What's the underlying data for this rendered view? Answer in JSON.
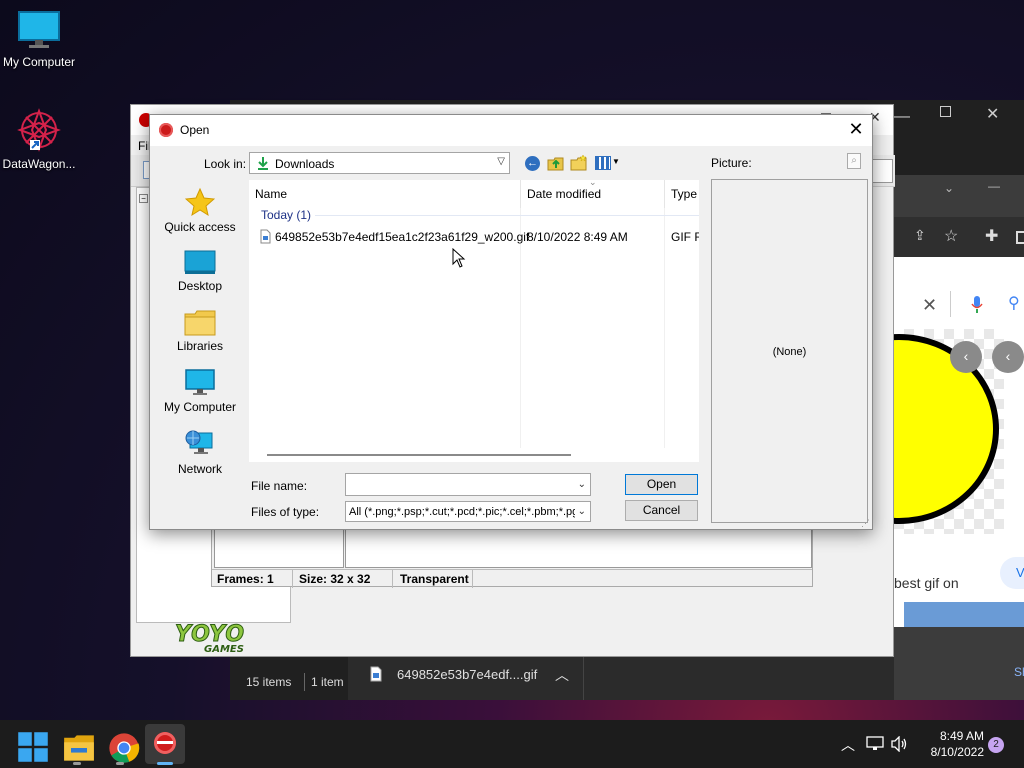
{
  "desktop": {
    "icons": [
      {
        "label": "My Computer"
      },
      {
        "label": "DataWagon..."
      }
    ]
  },
  "background": {
    "gm_menu_partial": "Fil",
    "status_bar": {
      "frames": "Frames: 1",
      "size": "Size: 32 x 32",
      "transparent": "Transparent"
    },
    "logo_text_top": "YOYO",
    "logo_text_bottom": "GAMES",
    "explorer_status": {
      "items": "15 items",
      "selected": "1 item"
    },
    "download_bar": {
      "filename": "649852e53b7e4edf....gif"
    },
    "browser_snippet": "best gif on",
    "browser_partial_right": "V",
    "browser_partial_bottom": "Sh"
  },
  "dialog": {
    "title": "Open",
    "look_in_label": "Look in:",
    "look_in_value": "Downloads",
    "picture_label": "Picture:",
    "preview_text": "(None)",
    "places": [
      {
        "label": "Quick access",
        "icon": "star-icon"
      },
      {
        "label": "Desktop",
        "icon": "desktop-icon"
      },
      {
        "label": "Libraries",
        "icon": "folder-icon"
      },
      {
        "label": "My Computer",
        "icon": "computer-icon"
      },
      {
        "label": "Network",
        "icon": "network-icon"
      }
    ],
    "columns": {
      "name": "Name",
      "date_modified": "Date modified",
      "type": "Type"
    },
    "group_header": "Today (1)",
    "files": [
      {
        "name": "649852e53b7e4edf15ea1c2f23a61f29_w200.gif",
        "date": "8/10/2022 8:49 AM",
        "type": "GIF Fi"
      }
    ],
    "file_name_label": "File name:",
    "file_name_value": "",
    "files_of_type_label": "Files of type:",
    "files_of_type_value": "All (*.png;*.psp;*.cut;*.pcd;*.pic;*.cel;*.pbm;*.pg",
    "open_button": "Open",
    "cancel_button": "Cancel"
  },
  "taskbar": {
    "time": "8:49 AM",
    "date": "8/10/2022",
    "notification_count": "2"
  },
  "colors": {
    "accent": "#0078d7",
    "gm_green": "#8dc63f",
    "list_group": "#1e3287"
  }
}
